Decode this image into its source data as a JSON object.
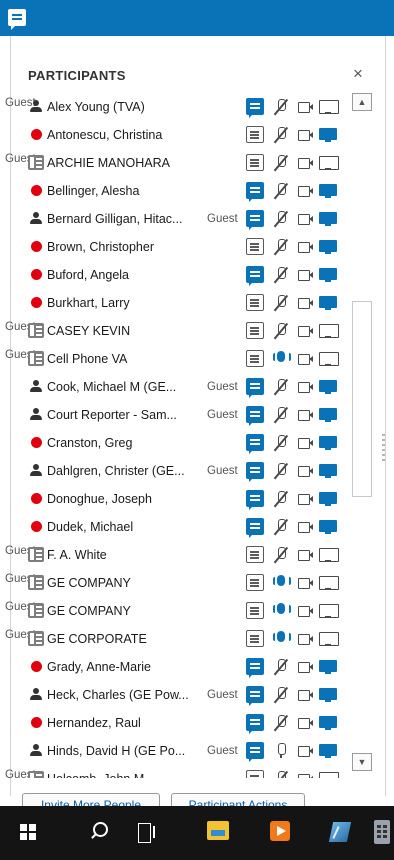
{
  "panel": {
    "title": "PARTICIPANTS",
    "close_glyph": "×",
    "close_icon": "close-icon",
    "header_icon": "chat-icon",
    "accent_color": "#0a73b7",
    "status_color": "#e0000f"
  },
  "participants": [
    {
      "name": "Alex Young (TVA)",
      "guest": "Guest",
      "guest_position": "inline",
      "kind": "person",
      "chat": "active",
      "mic": "muted",
      "screen": "idle"
    },
    {
      "name": "Antonescu, Christina",
      "guest": "",
      "kind": "status-dot",
      "chat": "idle",
      "mic": "muted",
      "screen": "active"
    },
    {
      "name": "ARCHIE MANOHARA",
      "guest": "Guest",
      "guest_position": "inline",
      "kind": "phone",
      "chat": "idle",
      "mic": "muted",
      "screen": "idle"
    },
    {
      "name": "Bellinger, Alesha",
      "guest": "",
      "kind": "status-dot",
      "chat": "active",
      "mic": "muted",
      "screen": "active"
    },
    {
      "name": "Bernard Gilligan, Hitac...",
      "guest": "Guest",
      "guest_position": "right",
      "kind": "person",
      "chat": "active",
      "mic": "muted",
      "screen": "active"
    },
    {
      "name": "Brown, Christopher",
      "guest": "",
      "kind": "status-dot",
      "chat": "idle",
      "mic": "muted",
      "screen": "active"
    },
    {
      "name": "Buford, Angela",
      "guest": "",
      "kind": "status-dot",
      "chat": "active",
      "mic": "muted",
      "screen": "active"
    },
    {
      "name": "Burkhart, Larry",
      "guest": "",
      "kind": "status-dot",
      "chat": "idle",
      "mic": "muted",
      "screen": "active"
    },
    {
      "name": "CASEY KEVIN",
      "guest": "Guest",
      "guest_position": "inline",
      "kind": "phone",
      "chat": "idle",
      "mic": "muted",
      "screen": "idle"
    },
    {
      "name": "Cell Phone  VA",
      "guest": "Guest",
      "guest_position": "inline",
      "kind": "phone",
      "chat": "idle",
      "mic": "speaking",
      "screen": "idle"
    },
    {
      "name": "Cook, Michael M (GE...",
      "guest": "Guest",
      "guest_position": "right",
      "kind": "person",
      "chat": "active",
      "mic": "muted",
      "screen": "active"
    },
    {
      "name": "Court Reporter - Sam...",
      "guest": "Guest",
      "guest_position": "right",
      "kind": "person",
      "chat": "active",
      "mic": "muted",
      "screen": "active"
    },
    {
      "name": "Cranston, Greg",
      "guest": "",
      "kind": "status-dot",
      "chat": "active",
      "mic": "muted",
      "screen": "active"
    },
    {
      "name": "Dahlgren, Christer (GE...",
      "guest": "Guest",
      "guest_position": "right",
      "kind": "person",
      "chat": "active",
      "mic": "muted",
      "screen": "active"
    },
    {
      "name": "Donoghue, Joseph",
      "guest": "",
      "kind": "status-dot",
      "chat": "active",
      "mic": "muted",
      "screen": "active"
    },
    {
      "name": "Dudek, Michael",
      "guest": "",
      "kind": "status-dot",
      "chat": "active",
      "mic": "muted",
      "screen": "active"
    },
    {
      "name": "F. A. White",
      "guest": "Guest",
      "guest_position": "inline",
      "kind": "phone",
      "chat": "idle",
      "mic": "muted",
      "screen": "idle"
    },
    {
      "name": "GE COMPANY",
      "guest": "Guest",
      "guest_position": "inline",
      "kind": "phone",
      "chat": "idle",
      "mic": "speaking",
      "screen": "idle"
    },
    {
      "name": "GE COMPANY",
      "guest": "Guest",
      "guest_position": "inline",
      "kind": "phone",
      "chat": "idle",
      "mic": "speaking",
      "screen": "idle"
    },
    {
      "name": "GE CORPORATE",
      "guest": "Guest",
      "guest_position": "inline",
      "kind": "phone",
      "chat": "idle",
      "mic": "speaking",
      "screen": "idle"
    },
    {
      "name": "Grady, Anne-Marie",
      "guest": "",
      "kind": "status-dot",
      "chat": "active",
      "mic": "muted",
      "screen": "active"
    },
    {
      "name": "Heck, Charles (GE Pow...",
      "guest": "Guest",
      "guest_position": "right",
      "kind": "person",
      "chat": "active",
      "mic": "muted",
      "screen": "active"
    },
    {
      "name": "Hernandez, Raul",
      "guest": "",
      "kind": "status-dot",
      "chat": "active",
      "mic": "muted",
      "screen": "active"
    },
    {
      "name": "Hinds, David H (GE Po...",
      "guest": "Guest",
      "guest_position": "right",
      "kind": "person",
      "chat": "active",
      "mic": "open",
      "screen": "active"
    },
    {
      "name": "Holcomb, John M",
      "guest": "Guest",
      "guest_position": "inline",
      "kind": "phone",
      "chat": "idle",
      "mic": "muted",
      "screen": "idle"
    }
  ],
  "scrollbar": {
    "up_glyph": "▲",
    "down_glyph": "▼"
  },
  "footer": {
    "invite_label": "Invite More People",
    "actions_label": "Participant Actions"
  },
  "taskbar": {
    "icons": [
      "windows-start-icon",
      "search-icon",
      "task-view-icon",
      "file-explorer-icon",
      "media-player-icon",
      "notes-app-icon",
      "calculator-icon"
    ]
  }
}
